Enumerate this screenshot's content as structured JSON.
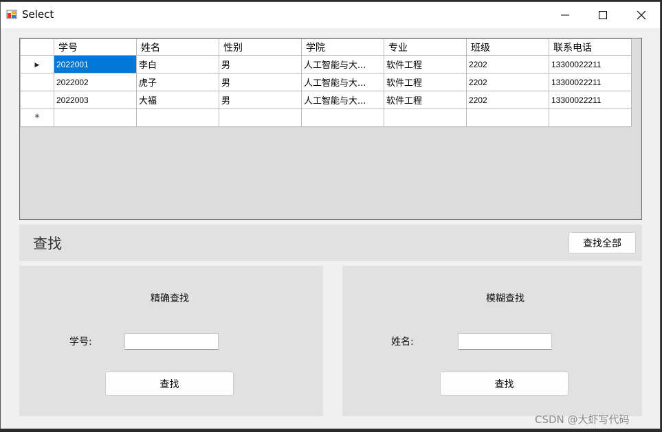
{
  "window": {
    "title": "Select",
    "controls": {
      "minimize": "minimize-icon",
      "maximize": "maximize-icon",
      "close": "close-icon"
    }
  },
  "grid": {
    "columns": [
      "学号",
      "姓名",
      "性别",
      "学院",
      "专业",
      "班级",
      "联系电话"
    ],
    "rows": [
      [
        "2022001",
        "李白",
        "男",
        "人工智能与大...",
        "软件工程",
        "2202",
        "13300022211"
      ],
      [
        "2022002",
        "虎子",
        "男",
        "人工智能与大...",
        "软件工程",
        "2202",
        "13300022211"
      ],
      [
        "2022003",
        "大福",
        "男",
        "人工智能与大...",
        "软件工程",
        "2202",
        "13300022211"
      ]
    ],
    "current_row_marker": "▶",
    "new_row_marker": "*",
    "selection_color": "#0078d7"
  },
  "search": {
    "title": "查找",
    "find_all_label": "查找全部",
    "exact": {
      "title": "精确查找",
      "field_label": "学号:",
      "field_value": "",
      "button_label": "查找"
    },
    "fuzzy": {
      "title": "模糊查找",
      "field_label": "姓名:",
      "field_value": "",
      "button_label": "查找"
    }
  },
  "watermark": "CSDN @大虾写代码"
}
